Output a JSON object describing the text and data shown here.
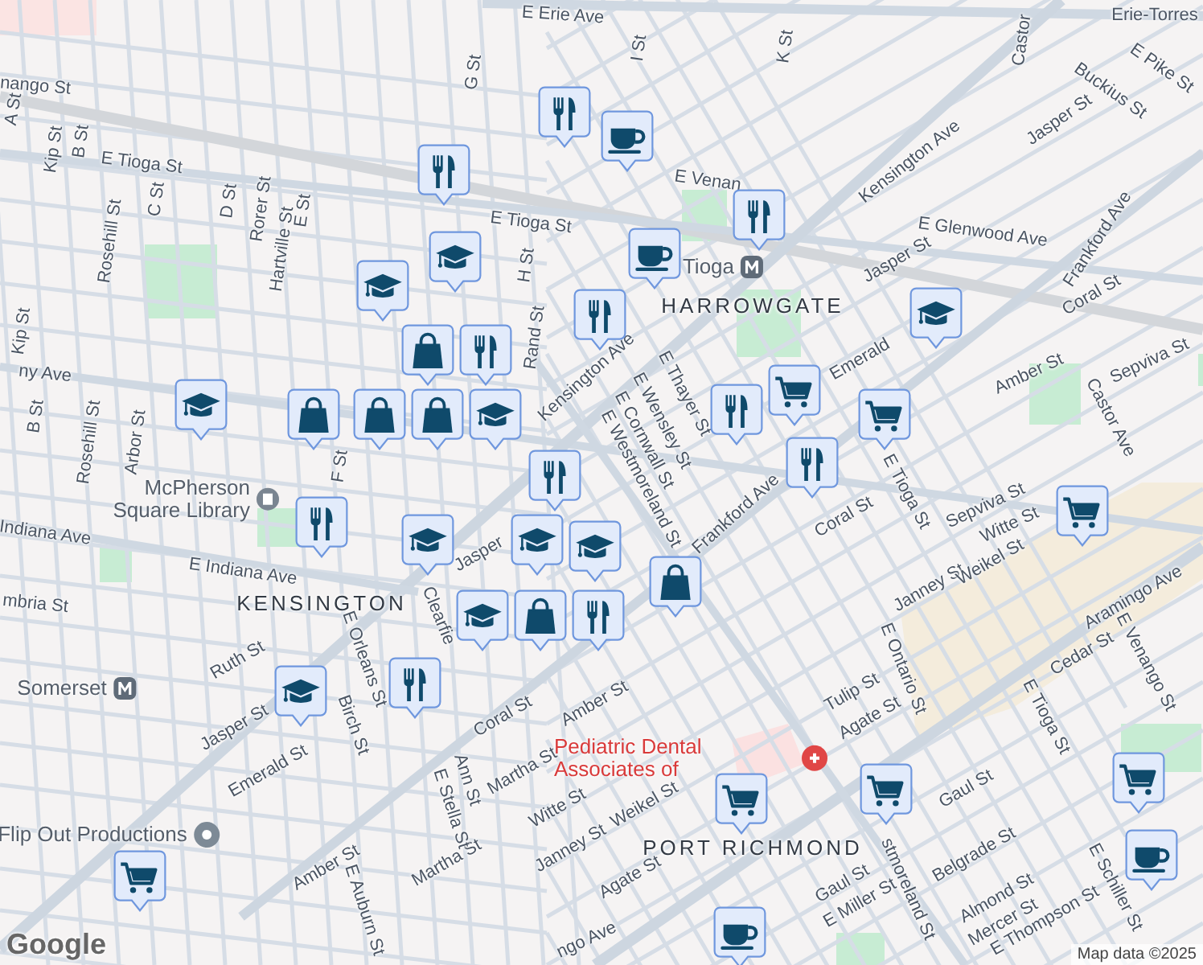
{
  "map": {
    "streets": [
      {
        "text": "E Erie Ave"
      },
      {
        "text": "Erie-Torres"
      },
      {
        "text": "nango St"
      },
      {
        "text": "A St"
      },
      {
        "text": "Kip St"
      },
      {
        "text": "B St"
      },
      {
        "text": "E Tioga St"
      },
      {
        "text": "Rosehill St"
      },
      {
        "text": "C St"
      },
      {
        "text": "D St"
      },
      {
        "text": "Rorer St"
      },
      {
        "text": "Hartville St"
      },
      {
        "text": "E St"
      },
      {
        "text": "G St"
      },
      {
        "text": "E Tioga St"
      },
      {
        "text": "H St"
      },
      {
        "text": "Rand St"
      },
      {
        "text": "Kip St"
      },
      {
        "text": "ny Ave"
      },
      {
        "text": "B St"
      },
      {
        "text": "Rosehill St"
      },
      {
        "text": "Arbor St"
      },
      {
        "text": "F St"
      },
      {
        "text": "I St"
      },
      {
        "text": "K St"
      },
      {
        "text": "Castor"
      },
      {
        "text": "Buckius St"
      },
      {
        "text": "E Pike St"
      },
      {
        "text": "Jasper St"
      },
      {
        "text": "Kensington Ave"
      },
      {
        "text": "E Venan"
      },
      {
        "text": "E Glenwood Ave"
      },
      {
        "text": "Frankford Ave"
      },
      {
        "text": "Coral St"
      },
      {
        "text": "Jasper St"
      },
      {
        "text": "Emerald"
      },
      {
        "text": "Amber St"
      },
      {
        "text": "Castor Ave"
      },
      {
        "text": "Sepviva St"
      },
      {
        "text": "Kensington Ave"
      },
      {
        "text": "E Thayer St"
      },
      {
        "text": "E Wensley St"
      },
      {
        "text": "E Cornwall St"
      },
      {
        "text": "E Westmoreland St"
      },
      {
        "text": "Frankford Ave"
      },
      {
        "text": "Coral St"
      },
      {
        "text": "E Tioga St"
      },
      {
        "text": "Sepviva St"
      },
      {
        "text": "Witte St"
      },
      {
        "text": "Janney St"
      },
      {
        "text": "Weikel St"
      },
      {
        "text": "Aramingo Ave"
      },
      {
        "text": "E Ontario St"
      },
      {
        "text": "Tulip St"
      },
      {
        "text": "Agate St"
      },
      {
        "text": "Cedar St"
      },
      {
        "text": "E Venango St"
      },
      {
        "text": "E Tioga St"
      },
      {
        "text": "Gaul St"
      },
      {
        "text": "Belgrade St"
      },
      {
        "text": "Almond St"
      },
      {
        "text": "Mercer St"
      },
      {
        "text": "E Thompson St"
      },
      {
        "text": "E Schiller St"
      },
      {
        "text": "Gaul St"
      },
      {
        "text": "E Miller St"
      },
      {
        "text": "stmoreland St"
      },
      {
        "text": "Agate St"
      },
      {
        "text": "Weikel St"
      },
      {
        "text": "Janney St"
      },
      {
        "text": "Witte St"
      },
      {
        "text": "Martha St"
      },
      {
        "text": "Martha St"
      },
      {
        "text": "Coral St"
      },
      {
        "text": "Amber St"
      },
      {
        "text": "Ann St"
      },
      {
        "text": "E Stella St"
      },
      {
        "text": "Amber St"
      },
      {
        "text": "E Auburn St"
      },
      {
        "text": "E Orleans St"
      },
      {
        "text": "Birch St"
      },
      {
        "text": "Emerald St"
      },
      {
        "text": "Jasper St"
      },
      {
        "text": "Ruth St"
      },
      {
        "text": "Indiana Ave"
      },
      {
        "text": "E Indiana Ave"
      },
      {
        "text": "mbria St"
      },
      {
        "text": "Clearfie"
      },
      {
        "text": "Jasper"
      },
      {
        "text": "ngo Ave"
      }
    ],
    "areas": [
      {
        "text": "HARROWGATE"
      },
      {
        "text": "KENSINGTON"
      },
      {
        "text": "PORT RICHMOND"
      }
    ],
    "places": [
      {
        "text": "McPherson Square Library",
        "kind": "library"
      },
      {
        "text": "Somerset",
        "kind": "station"
      },
      {
        "text": "Tioga",
        "kind": "station"
      },
      {
        "text": "Flip Out Productions",
        "kind": "venue"
      },
      {
        "text": "Pediatric Dental Associates of",
        "kind": "dental"
      }
    ],
    "pins": [
      {
        "kind": "restaurant"
      },
      {
        "kind": "cafe"
      },
      {
        "kind": "restaurant"
      },
      {
        "kind": "school"
      },
      {
        "kind": "school"
      },
      {
        "kind": "shopping"
      },
      {
        "kind": "restaurant"
      },
      {
        "kind": "cafe"
      },
      {
        "kind": "restaurant"
      },
      {
        "kind": "school"
      },
      {
        "kind": "restaurant"
      },
      {
        "kind": "school"
      },
      {
        "kind": "shopping"
      },
      {
        "kind": "shopping"
      },
      {
        "kind": "shopping"
      },
      {
        "kind": "restaurant"
      },
      {
        "kind": "school"
      },
      {
        "kind": "grocery"
      },
      {
        "kind": "restaurant"
      },
      {
        "kind": "restaurant"
      },
      {
        "kind": "grocery"
      },
      {
        "kind": "grocery"
      },
      {
        "kind": "school"
      },
      {
        "kind": "school"
      },
      {
        "kind": "school"
      },
      {
        "kind": "restaurant"
      },
      {
        "kind": "school"
      },
      {
        "kind": "shopping"
      },
      {
        "kind": "shopping"
      },
      {
        "kind": "restaurant"
      },
      {
        "kind": "restaurant"
      },
      {
        "kind": "school"
      },
      {
        "kind": "grocery"
      },
      {
        "kind": "grocery"
      },
      {
        "kind": "grocery"
      },
      {
        "kind": "cafe"
      },
      {
        "kind": "grocery"
      },
      {
        "kind": "cafe"
      }
    ],
    "logo": "Google",
    "attribution": "Map data ©2025"
  }
}
